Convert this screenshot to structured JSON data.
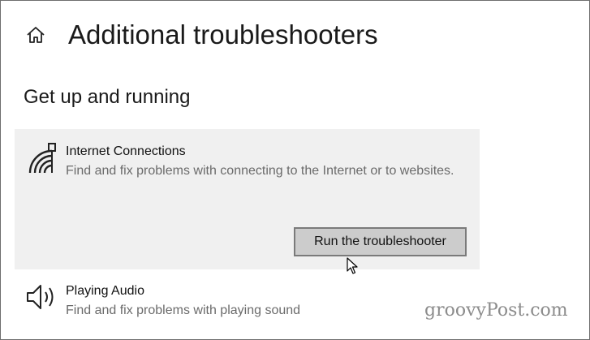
{
  "header": {
    "home_icon": "home-icon",
    "title": "Additional troubleshooters"
  },
  "section": {
    "title": "Get up and running"
  },
  "troubleshooters": [
    {
      "icon": "internet-connections-icon",
      "name": "Internet Connections",
      "description": "Find and fix problems with connecting to the Internet or to websites.",
      "selected": true,
      "run_button_label": "Run the troubleshooter"
    },
    {
      "icon": "speaker-icon",
      "name": "Playing Audio",
      "description": "Find and fix problems with playing sound",
      "selected": false
    }
  ],
  "watermark": "groovyPost.com",
  "colors": {
    "selected_card_bg": "#f0f0f0",
    "button_bg": "#cccccc",
    "button_border": "#7a7a7a",
    "secondary_text": "#6b6b6b"
  }
}
